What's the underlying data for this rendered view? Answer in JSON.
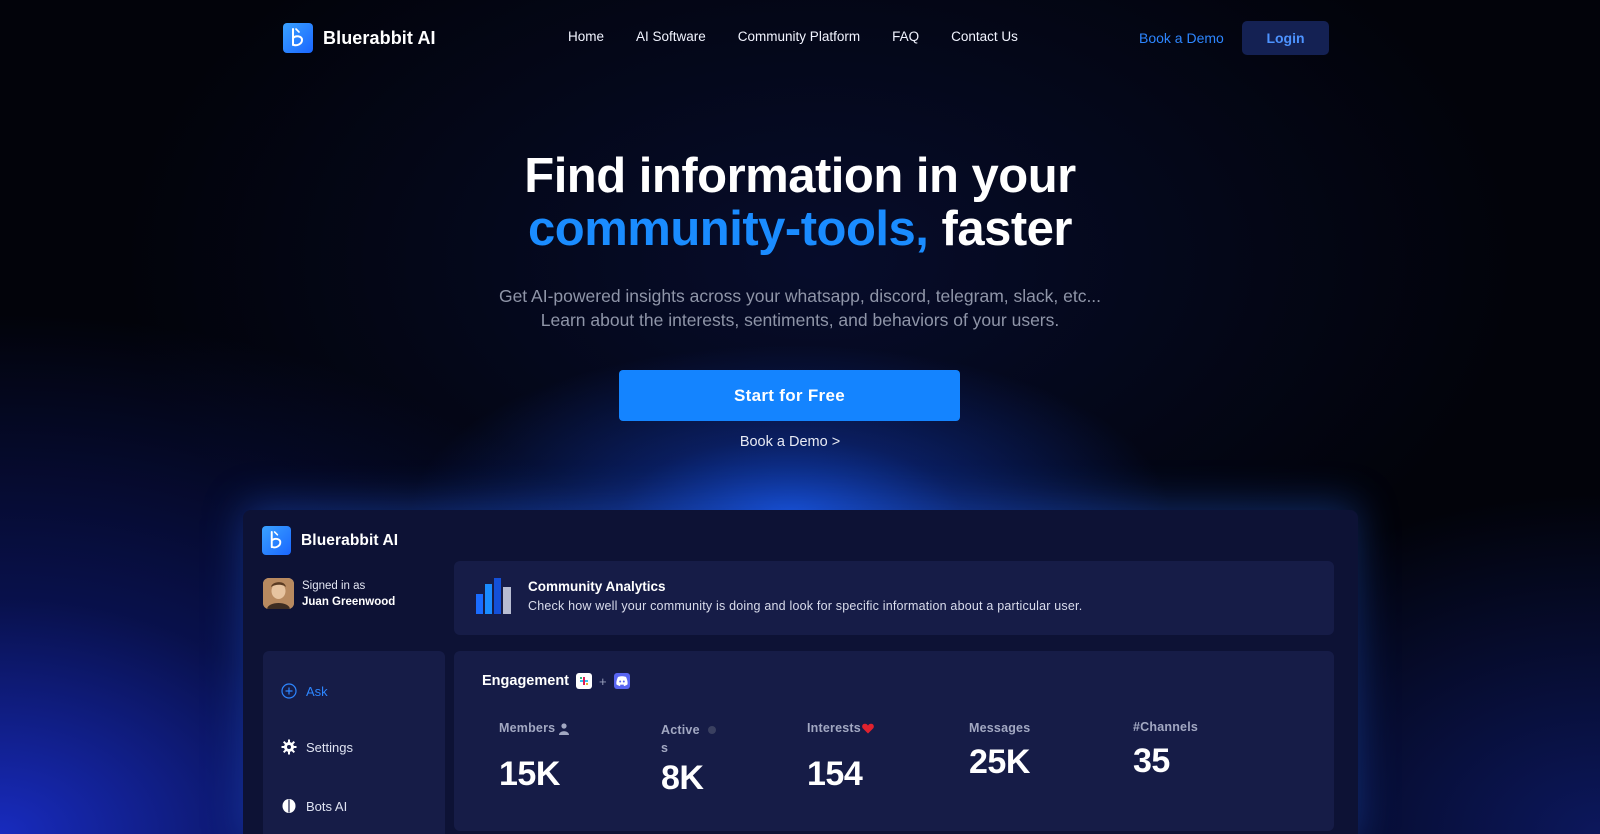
{
  "brand": {
    "name": "Bluerabbit AI"
  },
  "nav": {
    "links": [
      "Home",
      "AI Software",
      "Community Platform",
      "FAQ",
      "Contact Us"
    ],
    "book_demo": "Book a Demo",
    "login": "Login"
  },
  "hero": {
    "title_line1": "Find information in your",
    "title_accent": "community-tools,",
    "title_end": "faster",
    "subtitle_line1": "Get AI-powered insights across your whatsapp, discord, telegram, slack, etc...",
    "subtitle_line2": "Learn about the interests, sentiments, and behaviors of your users.",
    "cta": "Start for Free",
    "secondary": "Book a Demo >"
  },
  "app": {
    "brand": "Bluerabbit AI",
    "signed_in_label": "Signed in as",
    "user_name": "Juan Greenwood",
    "sidebar": [
      {
        "label": "Ask",
        "icon": "plus-circle-icon"
      },
      {
        "label": "Settings",
        "icon": "gear-icon"
      },
      {
        "label": "Bots AI",
        "icon": "brain-icon"
      }
    ],
    "analytics": {
      "title": "Community Analytics",
      "description": "Check how well your community is doing and look for specific information about a particular user."
    },
    "engagement": {
      "title": "Engagement",
      "plus": "+",
      "stats": [
        {
          "label": "Members",
          "label_extra": "",
          "value": "15K",
          "icon": "user-icon"
        },
        {
          "label": "Active",
          "label_extra": "s",
          "value": "8K",
          "icon": "status-dot-icon"
        },
        {
          "label": "Interests",
          "label_extra": "",
          "value": "154",
          "icon": "heart-icon"
        },
        {
          "label": "Messages",
          "label_extra": "",
          "value": "25K",
          "icon": ""
        },
        {
          "label": "#Channels",
          "label_extra": "",
          "value": "35",
          "icon": ""
        }
      ]
    }
  },
  "colors": {
    "accent": "#1a8cff",
    "cta": "#1484ff",
    "card": "#161c47",
    "panel": "#0d1235",
    "heart": "#e0222e"
  }
}
